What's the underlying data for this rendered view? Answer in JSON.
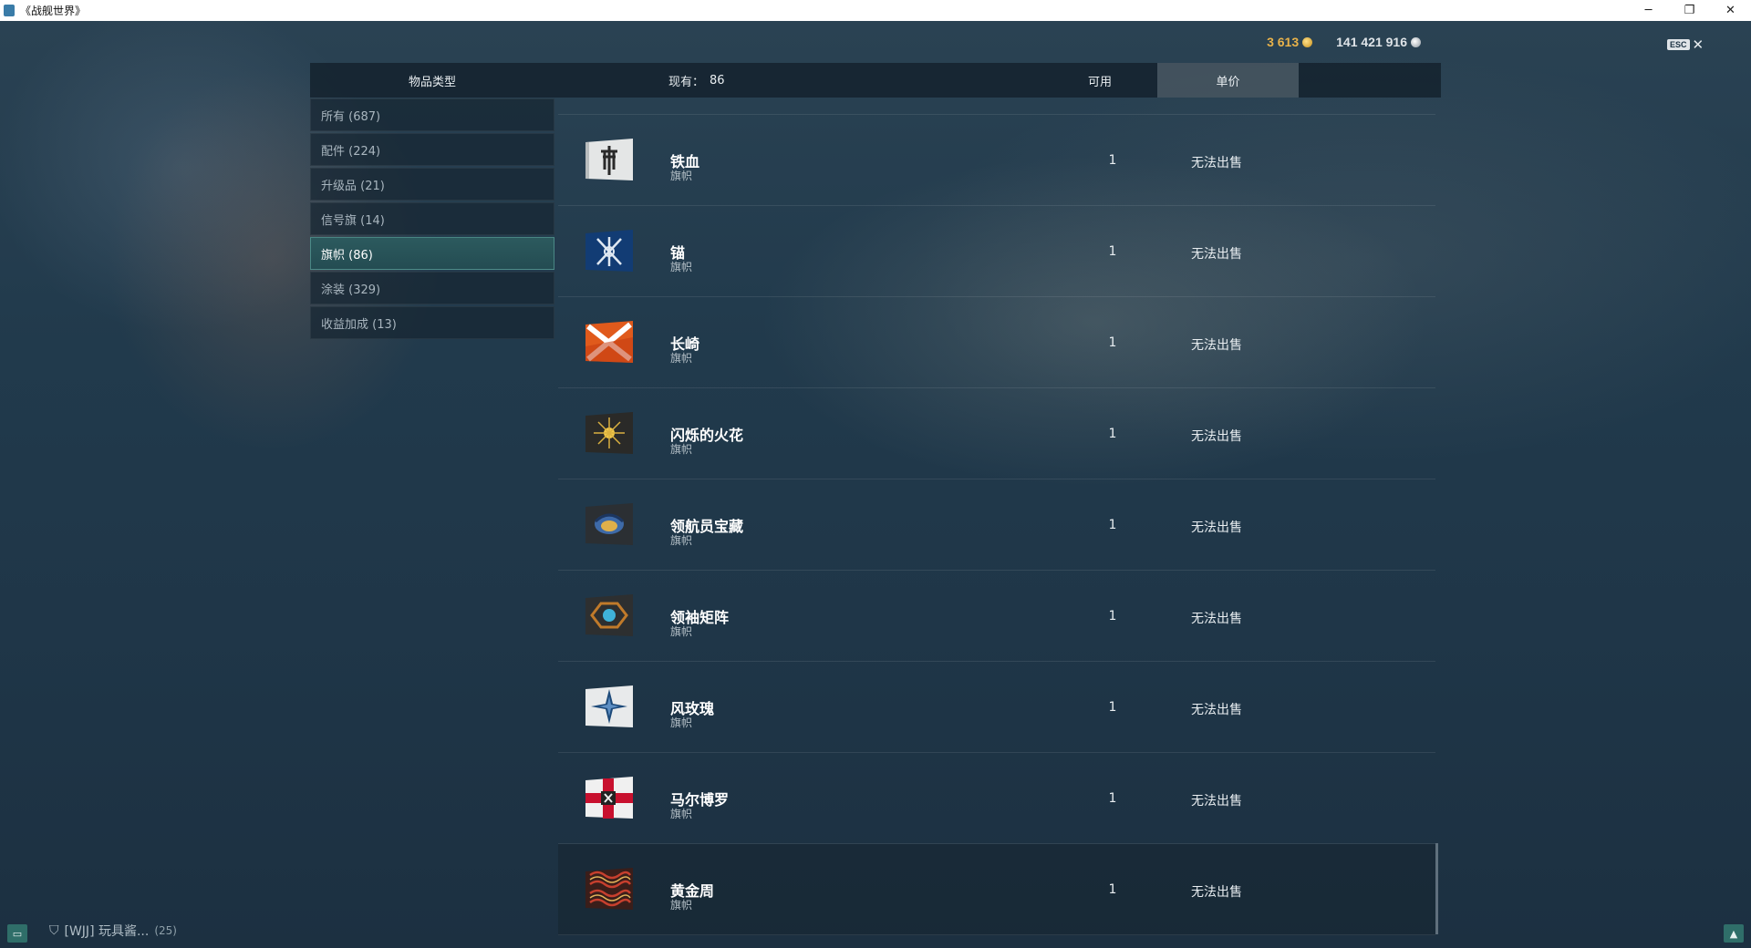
{
  "window": {
    "title": "《战舰世界》",
    "minimize_glyph": "─",
    "restore_glyph": "❐",
    "close_glyph": "✕"
  },
  "currency": {
    "gold": "3 613",
    "silver": "141 421 916"
  },
  "esc": {
    "label": "ESC",
    "close_glyph": "✕"
  },
  "header": {
    "type": "物品类型",
    "owned_label": "现有：",
    "owned_value": "86",
    "available": "可用",
    "price": "单价"
  },
  "categories": [
    {
      "label": "所有 (687)",
      "active": false
    },
    {
      "label": "配件 (224)",
      "active": false
    },
    {
      "label": "升级品 (21)",
      "active": false
    },
    {
      "label": "信号旗 (14)",
      "active": false
    },
    {
      "label": "旗帜 (86)",
      "active": true
    },
    {
      "label": "涂装 (329)",
      "active": false
    },
    {
      "label": "收益加成 (13)",
      "active": false
    }
  ],
  "items": [
    {
      "name": "铁血",
      "type": "旗帜",
      "qty": "1",
      "price": "无法出售",
      "icon": "iron-blood-flag-icon"
    },
    {
      "name": "锚",
      "type": "旗帜",
      "qty": "1",
      "price": "无法出售",
      "icon": "anchor-flag-icon"
    },
    {
      "name": "长崎",
      "type": "旗帜",
      "qty": "1",
      "price": "无法出售",
      "icon": "nagasaki-flag-icon"
    },
    {
      "name": "闪烁的火花",
      "type": "旗帜",
      "qty": "1",
      "price": "无法出售",
      "icon": "sparkle-flag-icon"
    },
    {
      "name": "领航员宝藏",
      "type": "旗帜",
      "qty": "1",
      "price": "无法出售",
      "icon": "navigator-treasure-flag-icon"
    },
    {
      "name": "领袖矩阵",
      "type": "旗帜",
      "qty": "1",
      "price": "无法出售",
      "icon": "leader-matrix-flag-icon"
    },
    {
      "name": "风玫瑰",
      "type": "旗帜",
      "qty": "1",
      "price": "无法出售",
      "icon": "wind-rose-flag-icon"
    },
    {
      "name": "马尔博罗",
      "type": "旗帜",
      "qty": "1",
      "price": "无法出售",
      "icon": "marlborough-flag-icon"
    },
    {
      "name": "黄金周",
      "type": "旗帜",
      "qty": "1",
      "price": "无法出售",
      "icon": "golden-week-flag-icon"
    }
  ],
  "bottom": {
    "clan": "[WJJ]  玩具酱...",
    "count": "(25)"
  },
  "colors": {
    "gold": "#e8b24a",
    "active_category": "#2c5a5e",
    "background": "#1d3344"
  }
}
